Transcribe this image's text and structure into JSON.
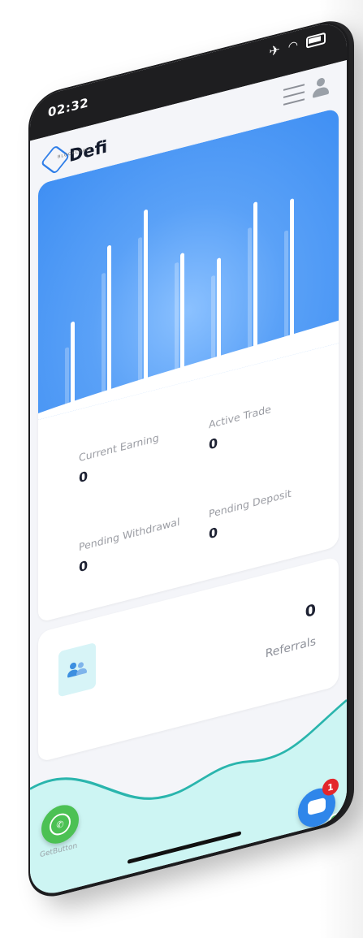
{
  "status_bar": {
    "time": "02:32",
    "icons": [
      "airplane-icon",
      "wifi-icon",
      "battery-icon"
    ]
  },
  "header": {
    "logo_text": "Defi",
    "logo_subtext": "BLOCKCHAIN",
    "menu_icon": "hamburger-menu-icon",
    "profile_icon": "user-icon"
  },
  "chart_data": {
    "type": "bar",
    "values": [
      0.42,
      0.75,
      0.88,
      0.62,
      0.55,
      0.78,
      0.75
    ],
    "shadow_values": [
      0.3,
      0.62,
      0.75,
      0.58,
      0.47,
      0.66,
      0.6
    ],
    "bar_color": "#ffffff",
    "background": "#4d98f5"
  },
  "stats": {
    "current_earning_label": "Current Earning",
    "current_earning_value": "0",
    "active_trade_label": "Active Trade",
    "active_trade_value": "0",
    "pending_withdrawal_label": "Pending Withdrawal",
    "pending_withdrawal_value": "0",
    "pending_deposit_label": "Pending Deposit",
    "pending_deposit_value": "0"
  },
  "referrals": {
    "value": "0",
    "label": "Referrals",
    "icon": "users-icon"
  },
  "widgets": {
    "whatsapp_label": "GetButton",
    "chat_badge": "1"
  },
  "colors": {
    "accent": "#3f8ff3",
    "teal_wave": "#2ab5ad",
    "wave_fill": "#cdf5f3"
  }
}
